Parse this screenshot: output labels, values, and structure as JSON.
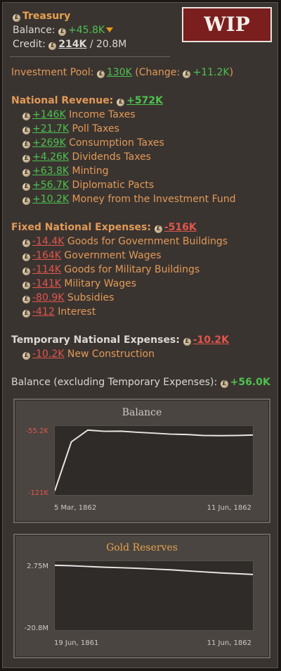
{
  "wip_label": "WIP",
  "treasury": {
    "title": "Treasury",
    "balance_label": "Balance:",
    "balance_value": "+45.8K",
    "credit_label": "Credit:",
    "credit_used": "214K",
    "credit_total": "/ 20.8M"
  },
  "investment": {
    "label": "Investment Pool:",
    "value": "130K",
    "change_open": "(Change:",
    "change_value": "+11.2K",
    "change_close": ")"
  },
  "revenue": {
    "label": "National Revenue:",
    "total": "+572K",
    "items": [
      {
        "value": "+146K",
        "label": "Income Taxes"
      },
      {
        "value": "+21.7K",
        "label": "Poll Taxes"
      },
      {
        "value": "+269K",
        "label": "Consumption Taxes"
      },
      {
        "value": "+4.26K",
        "label": "Dividends Taxes"
      },
      {
        "value": "+63.8K",
        "label": "Minting"
      },
      {
        "value": "+56.7K",
        "label": "Diplomatic Pacts"
      },
      {
        "value": "+10.2K",
        "label": "Money from the Investment Fund"
      }
    ]
  },
  "fixed": {
    "label": "Fixed National Expenses:",
    "total": "-516K",
    "items": [
      {
        "value": "-14.4K",
        "label": "Goods for Government Buildings"
      },
      {
        "value": "-164K",
        "label": "Government Wages"
      },
      {
        "value": "-114K",
        "label": "Goods for Military Buildings"
      },
      {
        "value": "-141K",
        "label": "Military Wages"
      },
      {
        "value": "-80.9K",
        "label": "Subsidies"
      },
      {
        "value": "-412",
        "label": "Interest"
      }
    ]
  },
  "temporary": {
    "label": "Temporary National Expenses:",
    "total": "-10.2K",
    "items": [
      {
        "value": "-10.2K",
        "label": "New Construction"
      }
    ]
  },
  "balance_excl": {
    "label": "Balance (excluding Temporary Expenses):",
    "value": "+56.0K"
  },
  "icons": {
    "currency": "pound-coin-icon",
    "trend": "down-triangle-icon"
  },
  "colors": {
    "positive": "#4cc24e",
    "negative": "#e2554b",
    "header": "#e6a24f",
    "chart_line": "#e8e4df"
  },
  "chart_data": [
    {
      "type": "line",
      "title": "Balance",
      "y_top_label": "-55.2K",
      "y_bottom_label": "-121K",
      "ylim": [
        -121,
        -55.2
      ],
      "x_start_label": "5 Mar, 1862",
      "x_end_label": "11 Jun, 1862",
      "series": [
        {
          "values": [
            -121,
            -68,
            -55.2,
            -56.5,
            -56.3,
            -57.5,
            -58.5,
            -59.5,
            -60.0,
            -61.0,
            -61.2,
            -61.0,
            -60.5
          ]
        }
      ]
    },
    {
      "type": "line",
      "title": "Gold Reserves",
      "y_top_label": "2.75M",
      "y_bottom_label": "-20.8M",
      "ylim": [
        -20.8,
        2.75
      ],
      "x_start_label": "19 Jun, 1861",
      "x_end_label": "11 Jun, 1862",
      "series": [
        {
          "values": [
            2.75,
            2.6,
            2.3,
            2.0,
            1.8,
            1.6,
            1.3,
            1.0,
            0.6,
            0.2,
            -0.2,
            -0.5,
            -0.8
          ]
        }
      ]
    }
  ]
}
